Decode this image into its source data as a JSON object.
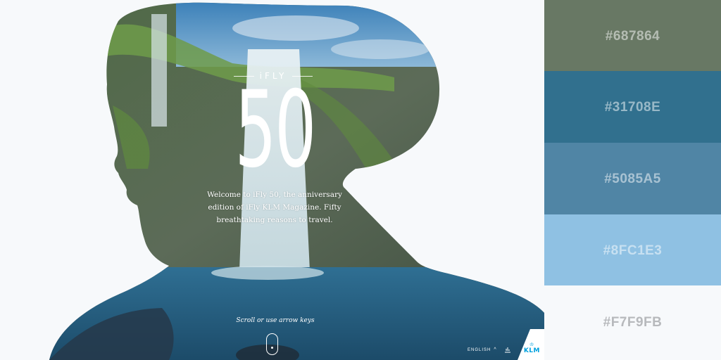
{
  "hero": {
    "brand": "iFLY",
    "number": "50",
    "intro": "Welcome to iFly 50, the anniversary edition of iFly KLM Magazine. Fifty breathtaking reasons to travel.",
    "scroll_hint": "Scroll or use arrow keys"
  },
  "footer": {
    "language": "ENGLISH",
    "logo": "KLM"
  },
  "palette": [
    {
      "hex": "#687864",
      "label": "#687864"
    },
    {
      "hex": "#31708E",
      "label": "#31708E"
    },
    {
      "hex": "#5085A5",
      "label": "#5085A5"
    },
    {
      "hex": "#8FC1E3",
      "label": "#8FC1E3"
    },
    {
      "hex": "#F7F9FB",
      "label": "#F7F9FB"
    }
  ],
  "icons": {
    "mouse": "mouse-scroll-icon",
    "chevron": "chevron-up-icon",
    "share": "share-icon",
    "crown": "crown-icon"
  }
}
